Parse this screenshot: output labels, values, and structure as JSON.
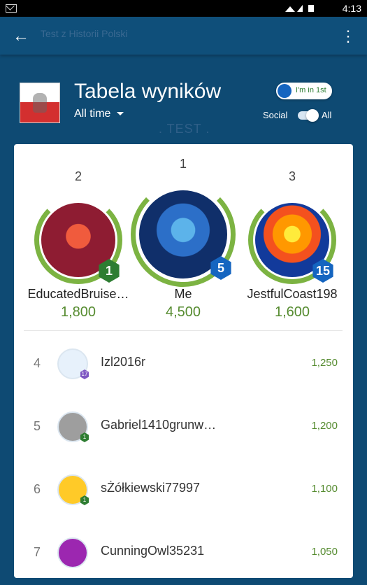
{
  "status_bar": {
    "time": "4:13"
  },
  "app_bar": {
    "title": "Test z Historii Polski"
  },
  "header": {
    "title": "Tabela wyników",
    "time_filter": "All time",
    "test_badge": ". TEST .",
    "rank_pill": "I'm in 1st",
    "social_label": "Social",
    "all_label": "All"
  },
  "podium": [
    {
      "place": "2",
      "name": "EducatedBruise…",
      "score": "1,800",
      "level": "1",
      "badge_color": "#2e7d32"
    },
    {
      "place": "1",
      "name": "Me",
      "score": "4,500",
      "level": "5",
      "badge_color": "#1565c0"
    },
    {
      "place": "3",
      "name": "JestfulCoast198",
      "score": "1,600",
      "level": "15",
      "badge_color": "#1565c0"
    }
  ],
  "rows": [
    {
      "rank": "4",
      "name": "Izl2016r",
      "score": "1,250",
      "level": "17",
      "badge_color": "#7e57c2"
    },
    {
      "rank": "5",
      "name": "Gabriel1410grunw…",
      "score": "1,200",
      "level": "1",
      "badge_color": "#2e7d32"
    },
    {
      "rank": "6",
      "name": "sŻółkiewski77997",
      "score": "1,100",
      "level": "1",
      "badge_color": "#2e7d32"
    },
    {
      "rank": "7",
      "name": "CunningOwl35231",
      "score": "1,050",
      "level": "",
      "badge_color": "#2e7d32"
    }
  ]
}
